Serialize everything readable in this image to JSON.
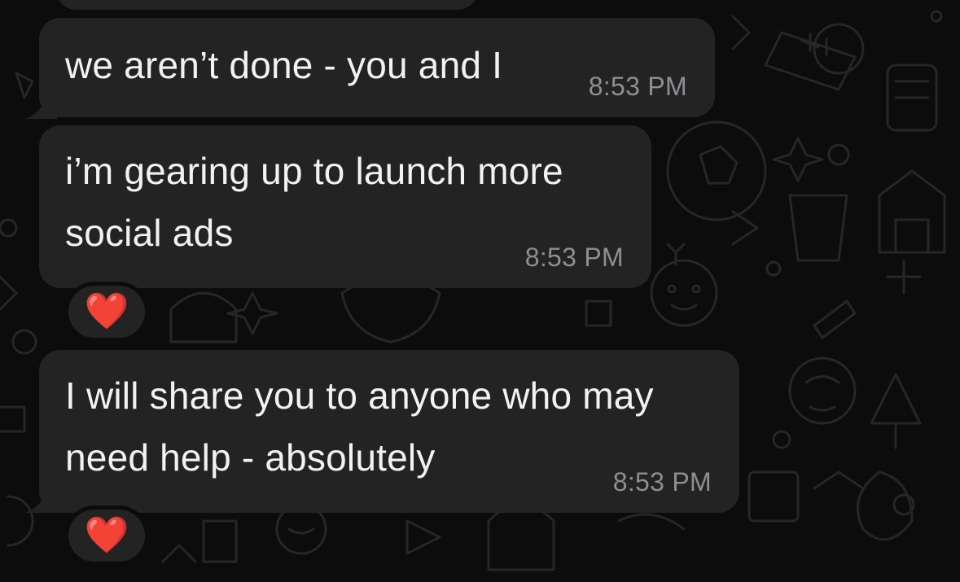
{
  "messages": [
    {
      "text": "we aren’t done - you and I",
      "time": "8:53 PM",
      "reaction": null
    },
    {
      "text": "i’m gearing up to launch more\nsocial ads",
      "time": "8:53 PM",
      "reaction": "❤️"
    },
    {
      "text": "I will share you to anyone who may\nneed help - absolutely",
      "time": "8:53 PM",
      "reaction": "❤️"
    }
  ],
  "colors": {
    "background": "#0c0c0c",
    "bubble": "#232323",
    "text": "#f2f2f2",
    "timestamp": "#8e8e93",
    "doodle": "#262626"
  },
  "icons": [
    "heart-reaction-icon"
  ]
}
